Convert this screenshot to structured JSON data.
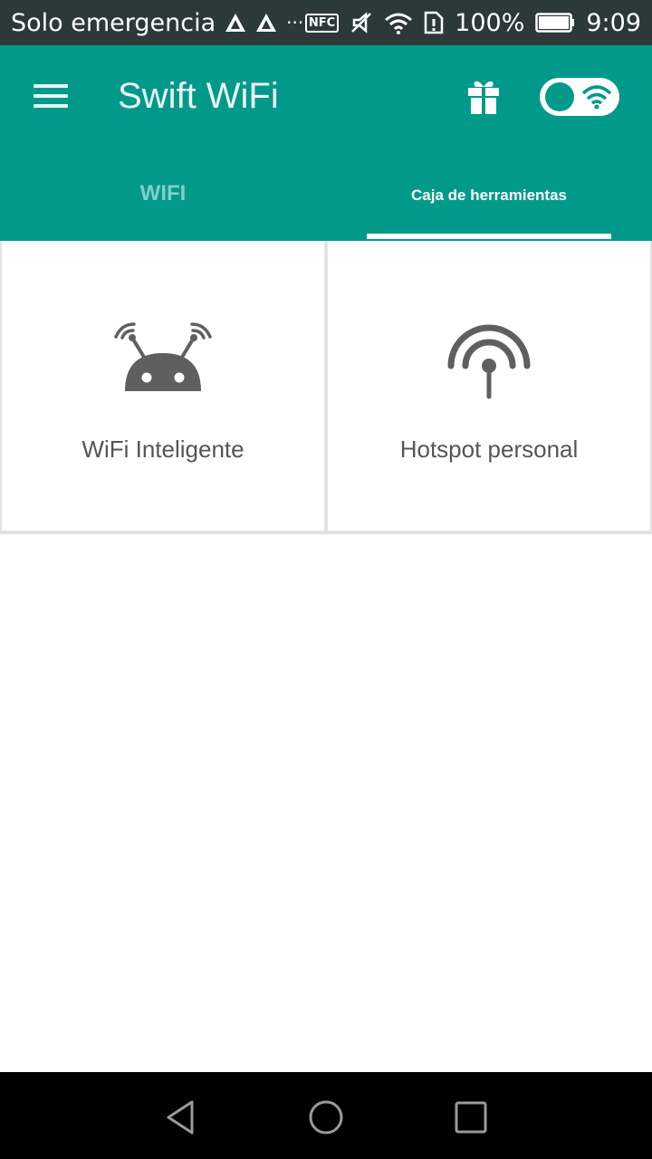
{
  "status_bar": {
    "carrier": "Solo emergencia",
    "battery": "100%",
    "time": "9:09",
    "nfc": "NFC",
    "more": "···",
    "icons": [
      "alert-triangle-icon",
      "alert-triangle-icon",
      "nfc-icon",
      "mute-icon",
      "wifi-icon",
      "sim-alert-icon",
      "battery-icon"
    ]
  },
  "app": {
    "title": "Swift WiFi",
    "icons": {
      "menu": "menu-icon",
      "gift": "gift-icon",
      "toggle": "wifi-toggle"
    }
  },
  "tabs": [
    {
      "label": "WIFI",
      "selected": false
    },
    {
      "label": "Caja de herramientas",
      "selected": true
    }
  ],
  "tools": [
    {
      "label": "WiFi Inteligente",
      "icon": "robot-antenna-icon"
    },
    {
      "label": "Hotspot personal",
      "icon": "hotspot-icon"
    }
  ],
  "nav": {
    "icons": [
      "back-icon",
      "home-icon",
      "recent-apps-icon"
    ]
  },
  "colors": {
    "primary": "#00998a",
    "status_bar": "#2b3a38",
    "tab_inactive": "#7fd0c6",
    "icon_gray": "#5f5f5f",
    "label_gray": "#555555"
  }
}
